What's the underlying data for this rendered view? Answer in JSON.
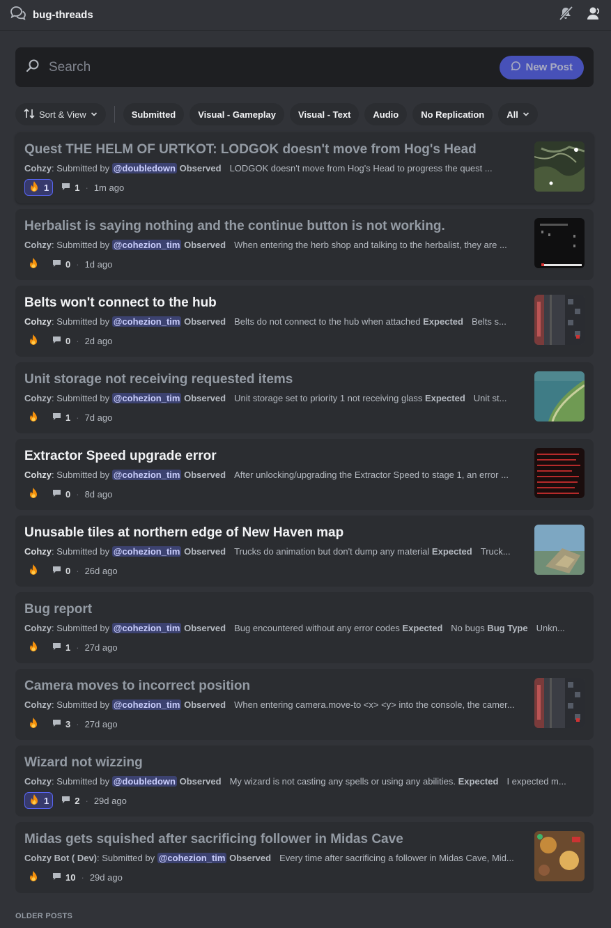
{
  "header": {
    "title": "bug-threads",
    "channel_icon": "threads-icon",
    "icons": [
      "notifications-muted-icon",
      "member-list-icon"
    ]
  },
  "search": {
    "placeholder": "Search",
    "new_post_label": "New Post"
  },
  "filters": {
    "sort_label": "Sort & View",
    "tags": [
      "Submitted",
      "Visual - Gameplay",
      "Visual - Text",
      "Audio",
      "No Replication"
    ],
    "all_label": "All"
  },
  "posts": [
    {
      "title": "Quest THE HELM OF URTKOT: LODGOK doesn't move from Hog's Head",
      "author": "Cohzy",
      "submitted_by": "Submitted by",
      "mention": "@doubledown",
      "label1": "Observed",
      "text1": "LODGOK doesn't move from Hog's Head to progress the quest ...",
      "label2": "",
      "text2": "",
      "label3": "",
      "text3": "",
      "reactions": "1",
      "comments": "1",
      "time": "1m ago",
      "reacted": true,
      "read": true,
      "thumb": "map"
    },
    {
      "title": "Herbalist is saying nothing and the continue button is not working.",
      "author": "Cohzy",
      "submitted_by": "Submitted by",
      "mention": "@cohezion_tim",
      "label1": "Observed",
      "text1": "When entering the herb shop and talking to the herbalist, they are ...",
      "label2": "",
      "text2": "",
      "label3": "",
      "text3": "",
      "reactions": "",
      "comments": "0",
      "time": "1d ago",
      "reacted": false,
      "read": true,
      "thumb": "dialog"
    },
    {
      "title": "Belts won't connect to the hub",
      "author": "Cohzy",
      "submitted_by": "Submitted by",
      "mention": "@cohezion_tim",
      "label1": "Observed",
      "text1": "Belts do not connect to the hub when attached",
      "label2": "Expected",
      "text2": "Belts s...",
      "label3": "",
      "text3": "",
      "reactions": "",
      "comments": "0",
      "time": "2d ago",
      "reacted": false,
      "read": false,
      "thumb": "factory"
    },
    {
      "title": "Unit storage not receiving requested items",
      "author": "Cohzy",
      "submitted_by": "Submitted by",
      "mention": "@cohezion_tim",
      "label1": "Observed",
      "text1": "Unit storage set to priority 1 not receiving glass",
      "label2": "Expected",
      "text2": "Unit st...",
      "label3": "",
      "text3": "",
      "reactions": "",
      "comments": "1",
      "time": "7d ago",
      "reacted": false,
      "read": true,
      "thumb": "coast"
    },
    {
      "title": "Extractor Speed upgrade error",
      "author": "Cohzy",
      "submitted_by": "Submitted by",
      "mention": "@cohezion_tim",
      "label1": "Observed",
      "text1": "After unlocking/upgrading the Extractor Speed to stage 1, an error ...",
      "label2": "",
      "text2": "",
      "label3": "",
      "text3": "",
      "reactions": "",
      "comments": "0",
      "time": "8d ago",
      "reacted": false,
      "read": false,
      "thumb": "console"
    },
    {
      "title": "Unusable tiles at northern edge of New Haven map",
      "author": "Cohzy",
      "submitted_by": "Submitted by",
      "mention": "@cohezion_tim",
      "label1": "Observed",
      "text1": "Trucks do animation but don't dump any material",
      "label2": "Expected",
      "text2": "Truck...",
      "label3": "",
      "text3": "",
      "reactions": "",
      "comments": "0",
      "time": "26d ago",
      "reacted": false,
      "read": false,
      "thumb": "terrain"
    },
    {
      "title": "Bug report",
      "author": "Cohzy",
      "submitted_by": "Submitted by",
      "mention": "@cohezion_tim",
      "label1": "Observed",
      "text1": "Bug encountered without any error codes",
      "label2": "Expected",
      "text2": "No bugs",
      "label3": "Bug Type",
      "text3": "Unkn...",
      "reactions": "",
      "comments": "1",
      "time": "27d ago",
      "reacted": false,
      "read": true,
      "thumb": ""
    },
    {
      "title": "Camera moves to incorrect position",
      "author": "Cohzy",
      "submitted_by": "Submitted by",
      "mention": "@cohezion_tim",
      "label1": "Observed",
      "text1": "When entering camera.move-to <x> <y> into the console, the camer...",
      "label2": "",
      "text2": "",
      "label3": "",
      "text3": "",
      "reactions": "",
      "comments": "3",
      "time": "27d ago",
      "reacted": false,
      "read": true,
      "thumb": "factory"
    },
    {
      "title": "Wizard not wizzing",
      "author": "Cohzy",
      "submitted_by": "Submitted by",
      "mention": "@doubledown",
      "label1": "Observed",
      "text1": "My wizard is not casting any spells or using any abilities.",
      "label2": "Expected",
      "text2": "I expected m...",
      "label3": "",
      "text3": "",
      "reactions": "1",
      "comments": "2",
      "time": "29d ago",
      "reacted": true,
      "read": true,
      "thumb": ""
    },
    {
      "title": "Midas gets squished after sacrificing follower in Midas Cave",
      "author": "Cohzy Bot ( Dev)",
      "submitted_by": "Submitted by",
      "mention": "@cohezion_tim",
      "label1": "Observed",
      "text1": "Every time after sacrificing a follower in Midas Cave, Mid...",
      "label2": "",
      "text2": "",
      "label3": "",
      "text3": "",
      "reactions": "",
      "comments": "10",
      "time": "29d ago",
      "reacted": false,
      "read": true,
      "thumb": "cave"
    }
  ],
  "older_posts_label": "OLDER POSTS",
  "colors": {
    "background": "#313338",
    "card": "#2b2d31",
    "accent": "#5865f2",
    "mention_bg": "#3c4270"
  }
}
